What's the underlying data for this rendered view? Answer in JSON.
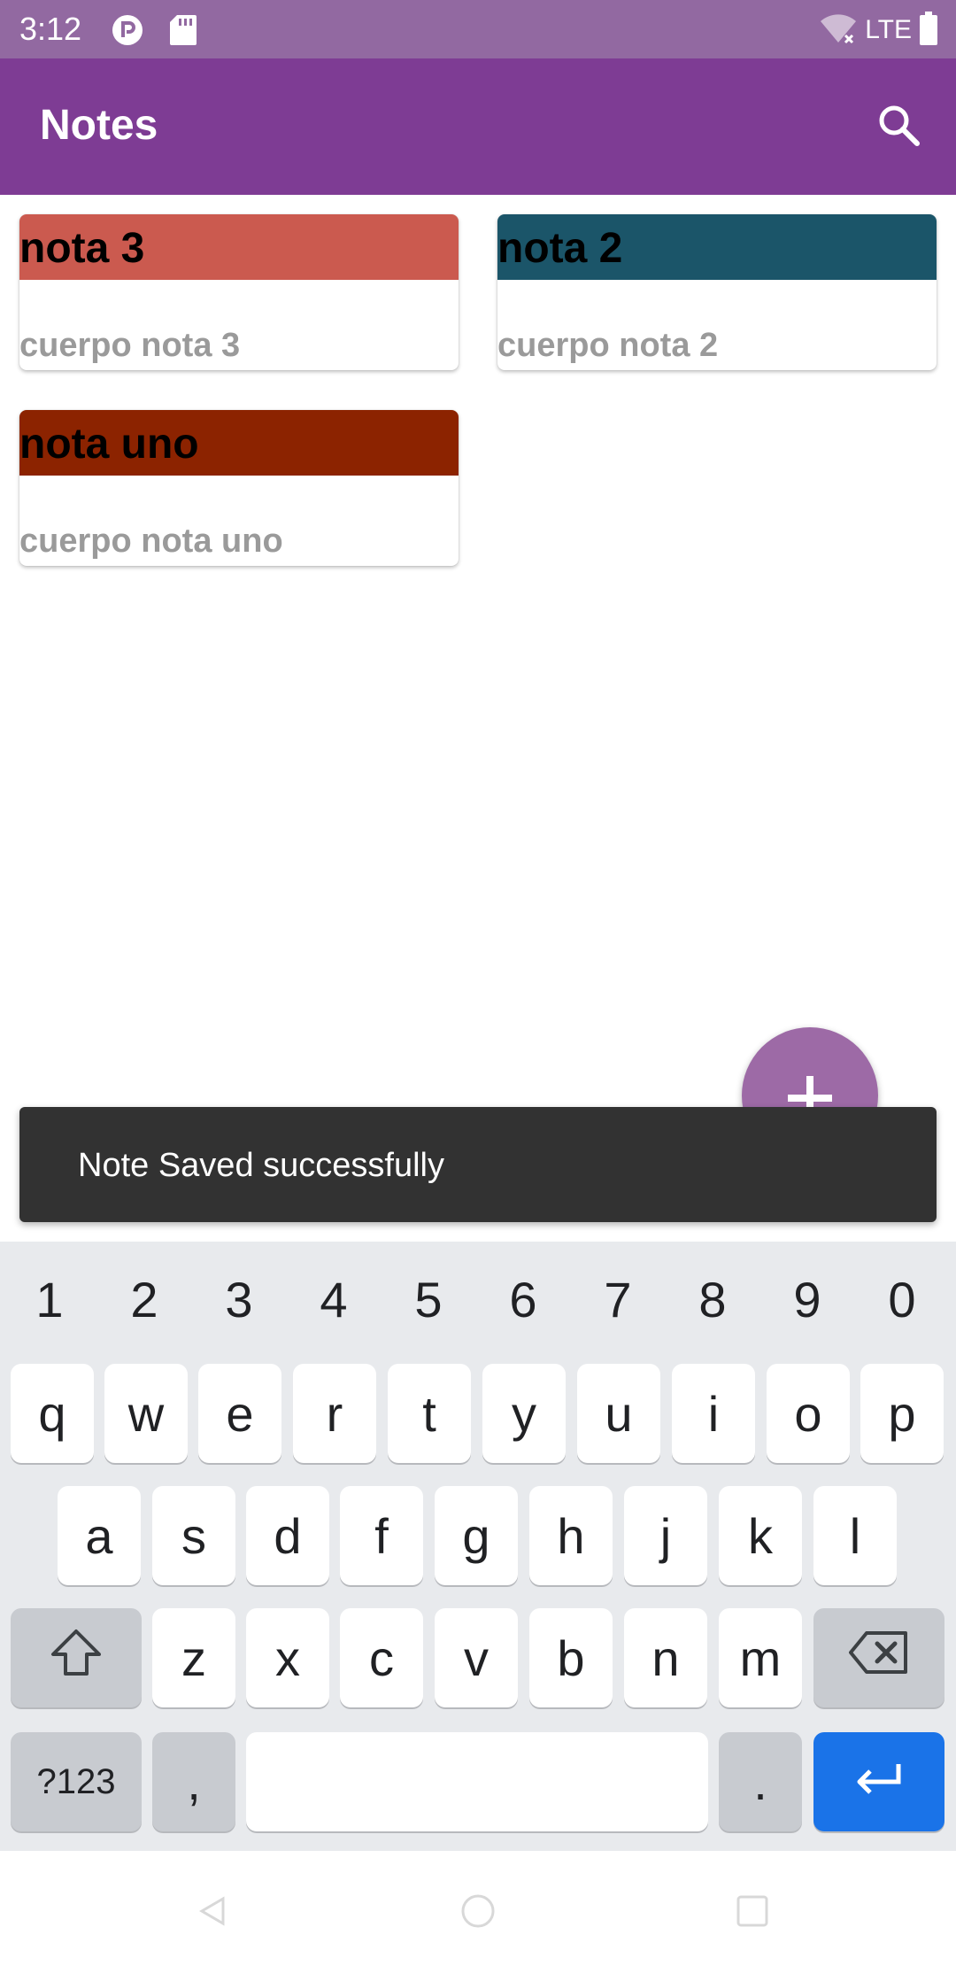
{
  "status_bar": {
    "time": "3:12",
    "network": "LTE"
  },
  "app_bar": {
    "title": "Notes",
    "search_icon": "search-icon"
  },
  "notes": [
    {
      "title": "nota 3",
      "body": "cuerpo nota 3",
      "color": "#cb5a4f"
    },
    {
      "title": "nota 2",
      "body": "cuerpo nota 2",
      "color": "#1b5569"
    },
    {
      "title": "nota uno",
      "body": "cuerpo nota uno",
      "color": "#8c2300"
    }
  ],
  "fab": {
    "label": "+",
    "icon": "add-icon",
    "color": "#9d6aa6"
  },
  "snackbar": {
    "message": "Note Saved successfully"
  },
  "keyboard": {
    "number_row": [
      "1",
      "2",
      "3",
      "4",
      "5",
      "6",
      "7",
      "8",
      "9",
      "0"
    ],
    "row1": [
      "q",
      "w",
      "e",
      "r",
      "t",
      "y",
      "u",
      "i",
      "o",
      "p"
    ],
    "row2": [
      "a",
      "s",
      "d",
      "f",
      "g",
      "h",
      "j",
      "k",
      "l"
    ],
    "row3": [
      "z",
      "x",
      "c",
      "v",
      "b",
      "n",
      "m"
    ],
    "symbols_label": "?123",
    "comma": ",",
    "period": ".",
    "shift_icon": "shift-icon",
    "backspace_icon": "backspace-icon",
    "enter_icon": "enter-icon"
  },
  "colors": {
    "status_bar": "#9269a1",
    "app_bar": "#7e3c94",
    "snackbar": "#323232",
    "keyboard_bg": "#e8eaed",
    "enter_key": "#1a73e8"
  }
}
